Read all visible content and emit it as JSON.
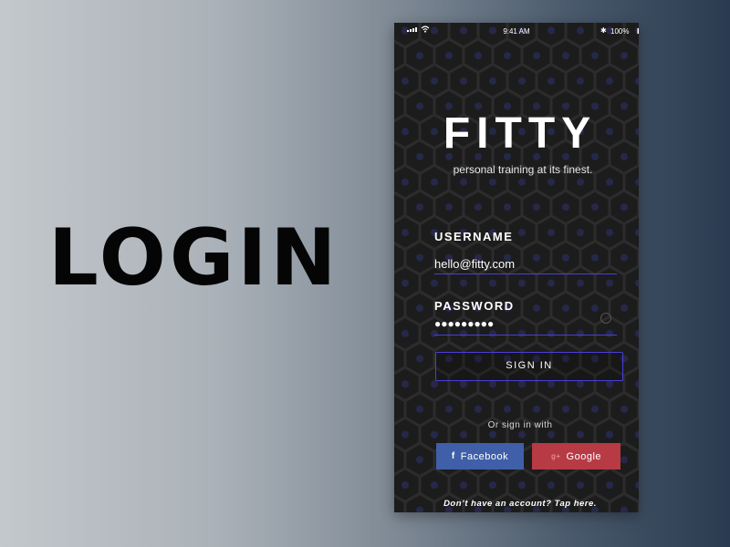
{
  "page": {
    "heading": "LOGIN"
  },
  "status_bar": {
    "time": "9:41 AM",
    "battery": "100%",
    "icons": [
      "signal-icon",
      "wifi-icon",
      "bluetooth-icon",
      "battery-icon"
    ]
  },
  "app": {
    "logo": "FITTY",
    "tagline": "personal training at its finest."
  },
  "form": {
    "username_label": "USERNAME",
    "username_value": "hello@fitty.com",
    "password_label": "PASSWORD",
    "password_value": "●●●●●●●●●",
    "signin_label": "SIGN IN"
  },
  "social": {
    "prompt": "Or sign in with",
    "facebook_label": "Facebook",
    "facebook_icon": "f",
    "google_label": "Google",
    "google_icon": "g+"
  },
  "footer": {
    "signup_text": "Don’t have an account? Tap here."
  },
  "colors": {
    "accent": "#4a3fd8",
    "facebook": "#3f5fa8",
    "google": "#b73a44",
    "phone_bg": "#1c1c1c"
  }
}
